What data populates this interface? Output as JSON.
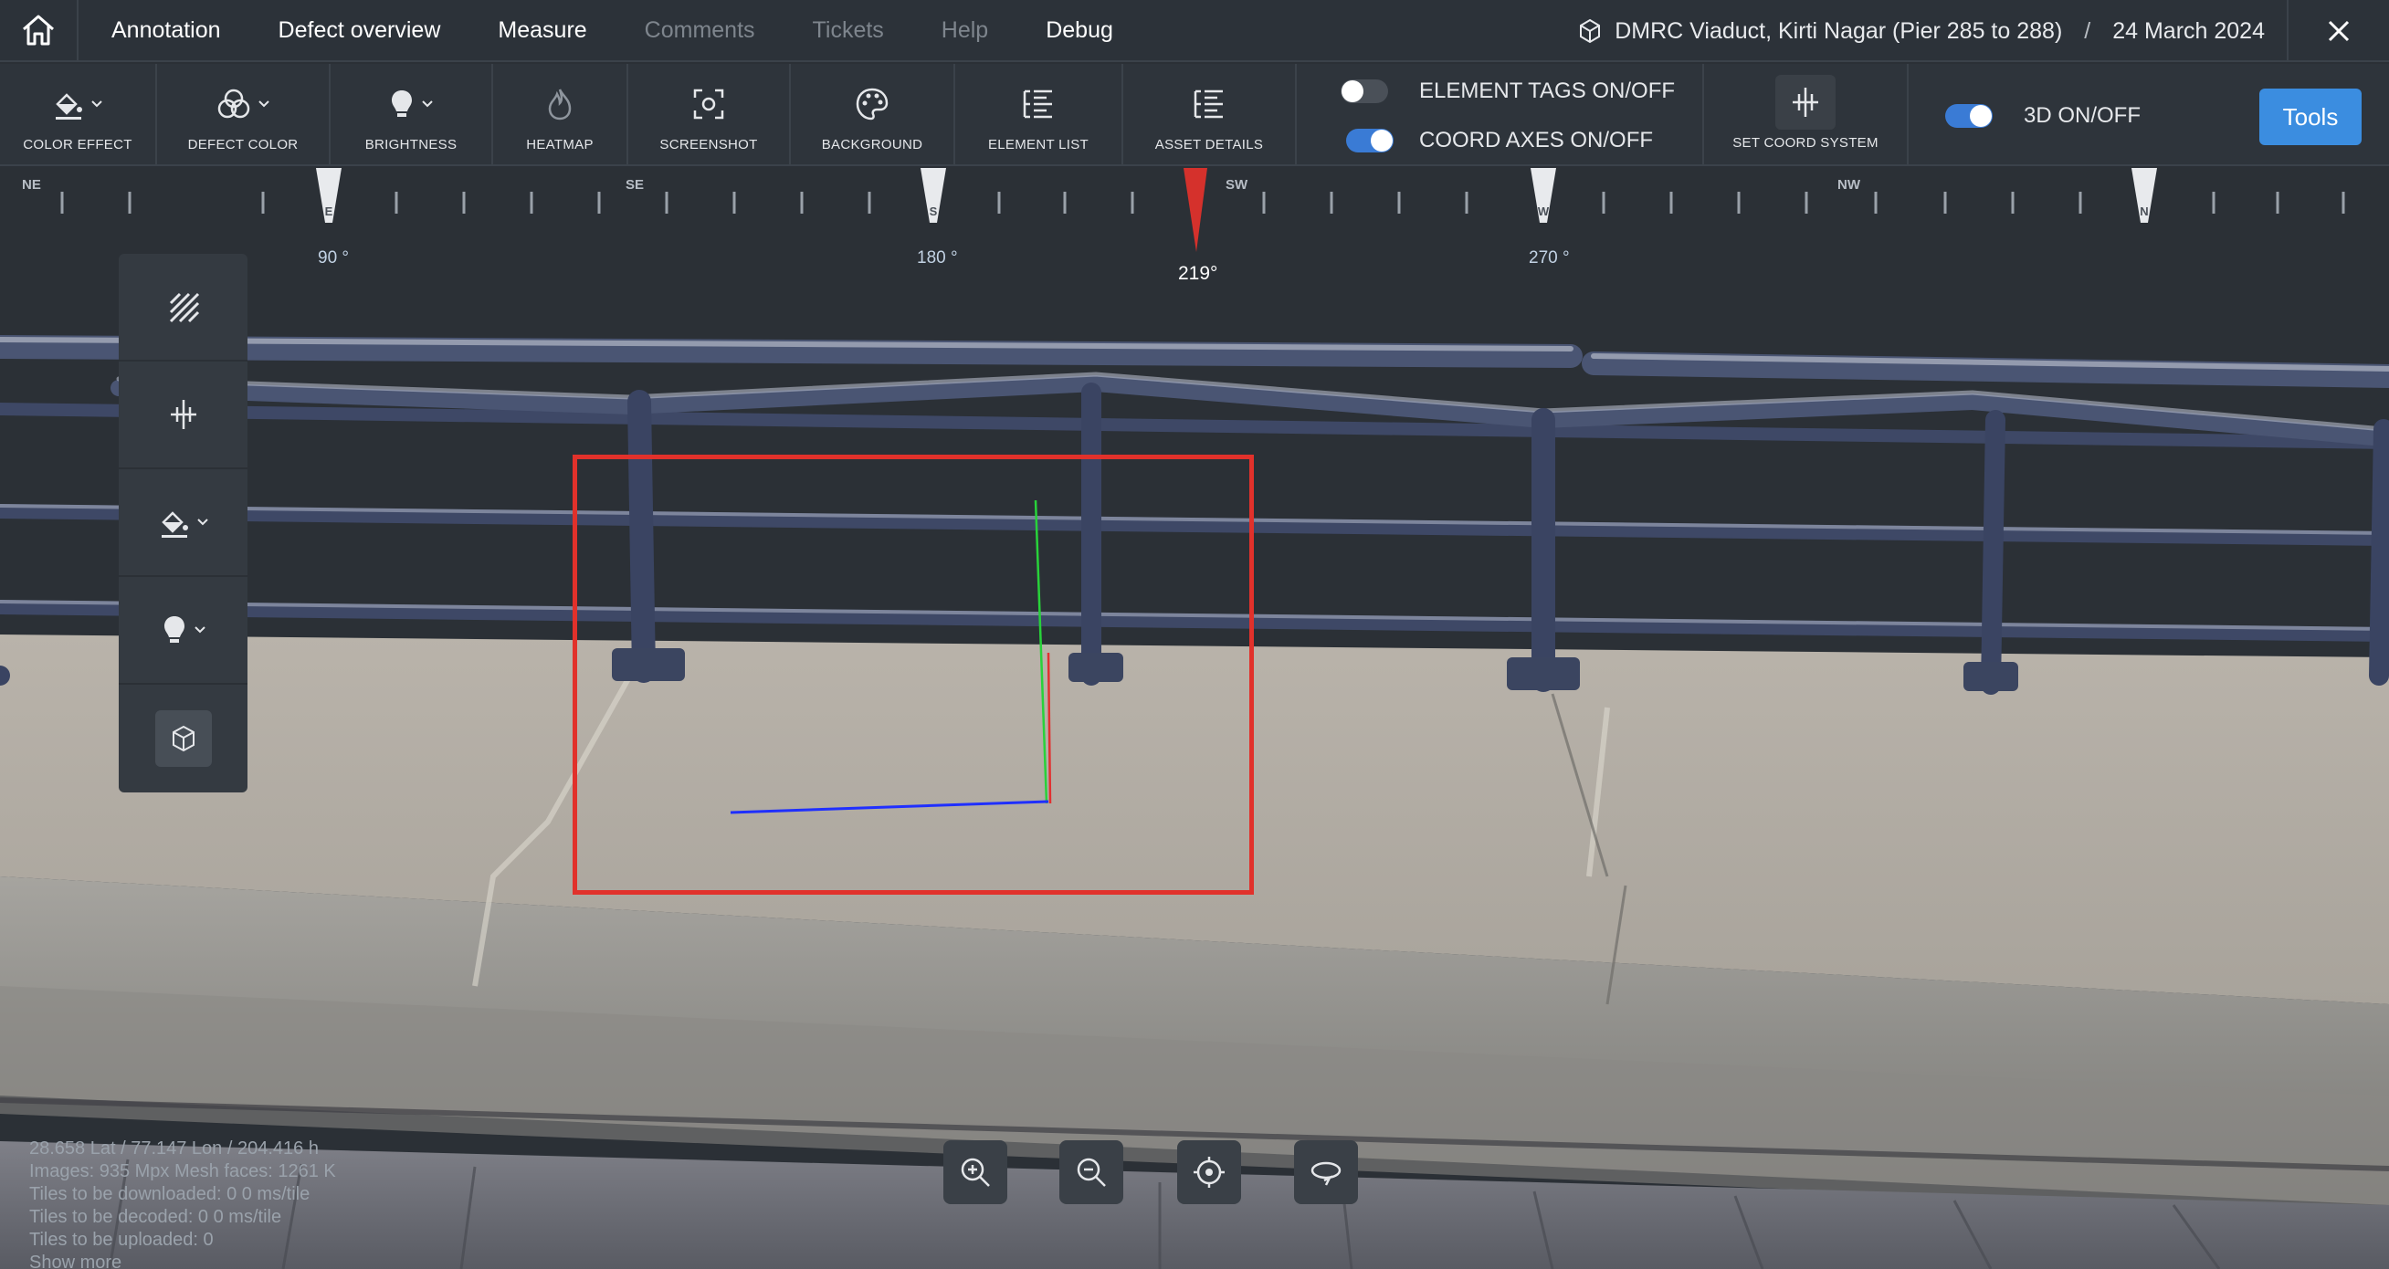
{
  "menu": {
    "items": [
      {
        "label": "Annotation",
        "disabled": false
      },
      {
        "label": "Defect overview",
        "disabled": false
      },
      {
        "label": "Measure",
        "disabled": false
      },
      {
        "label": "Comments",
        "disabled": true
      },
      {
        "label": "Tickets",
        "disabled": true
      },
      {
        "label": "Help",
        "disabled": true
      },
      {
        "label": "Debug",
        "disabled": false
      }
    ],
    "project_name": "DMRC Viaduct, Kirti Nagar (Pier 285 to 288)",
    "separator": "/",
    "date": "24 March 2024"
  },
  "toolbar": {
    "color_effect": "COLOR EFFECT",
    "defect_color": "DEFECT COLOR",
    "brightness": "BRIGHTNESS",
    "heatmap": "HEATMAP",
    "screenshot": "SCREENSHOT",
    "background": "BACKGROUND",
    "element_list": "ELEMENT LIST",
    "asset_details": "ASSET DETAILS",
    "element_tags": {
      "label": "ELEMENT TAGS ON/OFF",
      "on": false
    },
    "coord_axes": {
      "label": "COORD AXES ON/OFF",
      "on": true
    },
    "set_coord_system": "SET COORD SYSTEM",
    "three_d": {
      "label": "3D ON/OFF",
      "on": true
    },
    "tools": "Tools"
  },
  "compass": {
    "directions": [
      "NE",
      "E",
      "SE",
      "S",
      "SW",
      "W",
      "NW",
      "N"
    ],
    "degrees": [
      "90 °",
      "180 °",
      "270 °"
    ],
    "heading": "219°"
  },
  "info": {
    "coords": "28.658 Lat / 77.147 Lon / 204.416 h",
    "images_mesh": "Images: 935 Mpx    Mesh faces: 1261 K",
    "download": "Tiles to be downloaded: 0     0 ms/tile",
    "decode": "Tiles to be decoded: 0     0 ms/tile",
    "upload": "Tiles to be uploaded: 0",
    "show_more": "Show more"
  },
  "colors": {
    "accent": "#3b8de0",
    "selection": "#e1312b",
    "panel": "#2e343b",
    "axis_x": "#1f2fff",
    "axis_y": "#28d23a",
    "axis_z": "#e23030"
  }
}
